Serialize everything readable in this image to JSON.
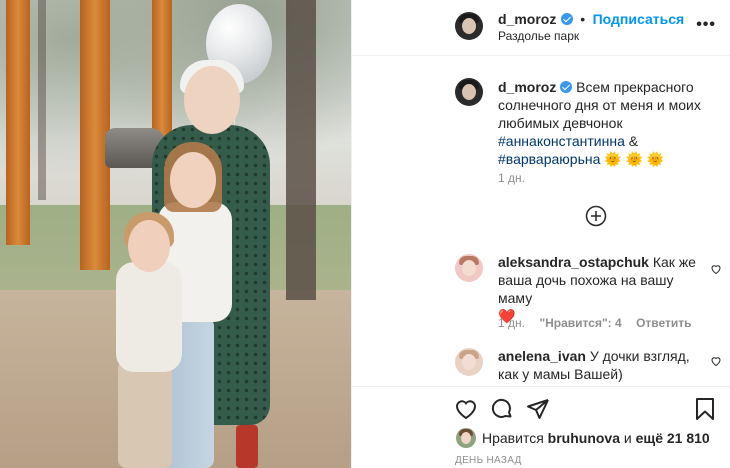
{
  "post": {
    "author": "d_moroz",
    "follow_label": "Подписаться",
    "location": "Раздолье парк",
    "more_icon": "•••"
  },
  "caption": {
    "author": "d_moroz",
    "text": "Всем прекрасного солнечного дня от меня и моих любимых девчонок",
    "tag1": "#аннаконстантинна",
    "amp": "&",
    "tag2": "#варвараюрьна",
    "emoji": "🌞 🌞 🌞",
    "time": "1 дн."
  },
  "load_more_icon": "plus-circle-icon",
  "comments": [
    {
      "author": "aleksandra_ostapchuk",
      "text": "Как же ваша дочь похожа на вашу маму",
      "emoji": "❤️",
      "time": "1 дн.",
      "likes": "\"Нравится\": 4",
      "reply": "Ответить"
    },
    {
      "author": "anelena_ivan",
      "text": "У дочки взгляд, как у мамы Вашей)"
    }
  ],
  "likes": {
    "prefix": "Нравится",
    "user": "bruhunova",
    "and": "и",
    "more": "ещё 21 810"
  },
  "date": "ДЕНЬ НАЗАД",
  "colors": {
    "link": "#0095f6",
    "hashtag": "#00376b",
    "muted": "#8e8e8e",
    "verified": "#3897f0"
  }
}
